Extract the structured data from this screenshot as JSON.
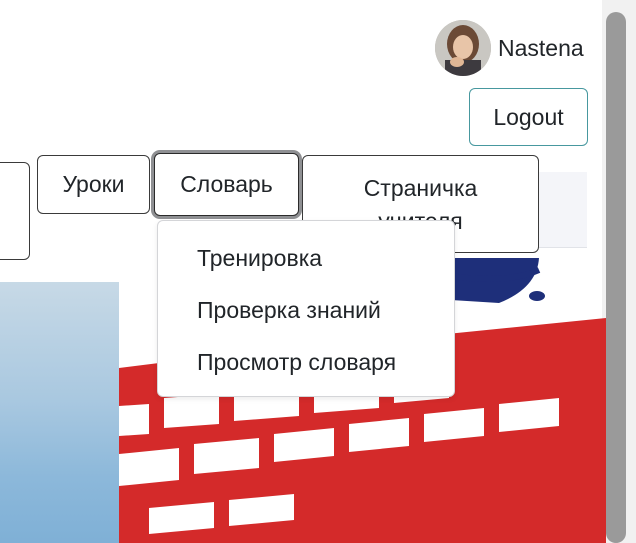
{
  "user": {
    "name": "Nastena",
    "avatar_icon": "user-avatar-photo"
  },
  "header": {
    "logout_label": "Logout"
  },
  "nav": {
    "lessons_label": "Уроки",
    "dictionary_label": "Словарь",
    "teacher_page_label": "Страничка",
    "teacher_page_label_line2": "учителя"
  },
  "dropdown": {
    "items": [
      {
        "label": "Тренировка"
      },
      {
        "label": "Проверка знаний"
      },
      {
        "label": "Просмотр словаря"
      }
    ]
  },
  "colors": {
    "logout_border": "#47989f",
    "logo_red": "#d42a2a",
    "logo_navy": "#1e2f7a"
  }
}
